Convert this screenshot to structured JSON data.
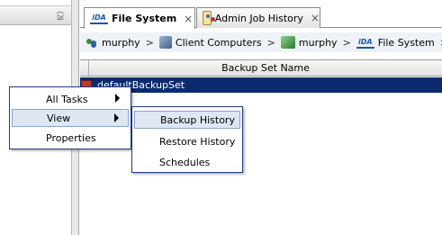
{
  "left_pane": {
    "pin_glyph": "⍄"
  },
  "tabs": [
    {
      "label": "File System",
      "close": "×",
      "icon": "ida-icon",
      "active": true,
      "icon_text": "iDA"
    },
    {
      "label": "Admin Job History",
      "close": "×",
      "icon": "admin-job-icon",
      "active": false
    }
  ],
  "breadcrumb": {
    "items": [
      {
        "label": "murphy",
        "icon": "users-icon"
      },
      {
        "label": "Client Computers",
        "icon": "client-computers-icon"
      },
      {
        "label": "murphy",
        "icon": "client-icon"
      },
      {
        "label": "File System",
        "icon": "ida-icon",
        "icon_text": "iDA"
      }
    ],
    "separator": ">"
  },
  "grid": {
    "columns": [
      "Backup Set Name"
    ],
    "rows": [
      {
        "name": "defaultBackupSet",
        "selected": true
      }
    ]
  },
  "context_menu": {
    "items": [
      {
        "label": "All Tasks",
        "has_submenu": true
      },
      {
        "label": "View",
        "has_submenu": true,
        "highlighted": true
      },
      {
        "label": "Properties",
        "has_submenu": false
      }
    ]
  },
  "submenu": {
    "items": [
      {
        "label": "Backup History",
        "highlighted": true
      },
      {
        "label": "Restore History"
      },
      {
        "label": "Schedules"
      }
    ]
  },
  "colors": {
    "selection": "#0c2a6e",
    "menu_highlight": "#dfe7f4",
    "menu_border": "#1e3a78"
  }
}
